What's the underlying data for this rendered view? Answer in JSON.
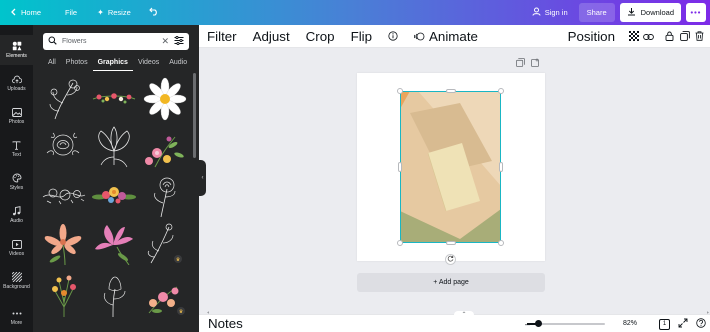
{
  "topbar": {
    "home": "Home",
    "file": "File",
    "resize": "Resize",
    "sign_in": "Sign in",
    "share": "Share",
    "download": "Download",
    "more": "•••"
  },
  "rail": {
    "items": [
      {
        "label": "Elements",
        "icon": "elements-icon"
      },
      {
        "label": "Uploads",
        "icon": "upload-cloud-icon"
      },
      {
        "label": "Photos",
        "icon": "photo-icon"
      },
      {
        "label": "Text",
        "icon": "text-t-icon"
      },
      {
        "label": "Styles",
        "icon": "palette-icon"
      },
      {
        "label": "Audio",
        "icon": "music-note-icon"
      },
      {
        "label": "Videos",
        "icon": "video-play-icon"
      },
      {
        "label": "Background",
        "icon": "background-pattern-icon"
      },
      {
        "label": "More",
        "icon": "more-dots-icon"
      }
    ]
  },
  "panel": {
    "search_value": "Flowers",
    "tabs": [
      "All",
      "Photos",
      "Graphics",
      "Videos",
      "Audio"
    ],
    "active_tab": "Graphics"
  },
  "toolbar": {
    "filter": "Filter",
    "adjust": "Adjust",
    "crop": "Crop",
    "flip": "Flip",
    "animate": "Animate",
    "position": "Position"
  },
  "canvas": {
    "add_page": "+ Add page"
  },
  "bottombar": {
    "notes": "Notes",
    "zoom": "82%",
    "zoom_level": 0.15,
    "page_count": "1"
  },
  "colors": {
    "accent": "#7d2ae8",
    "selection": "#19b6c4",
    "rail_bg": "#18191b",
    "panel_bg": "#252627"
  }
}
